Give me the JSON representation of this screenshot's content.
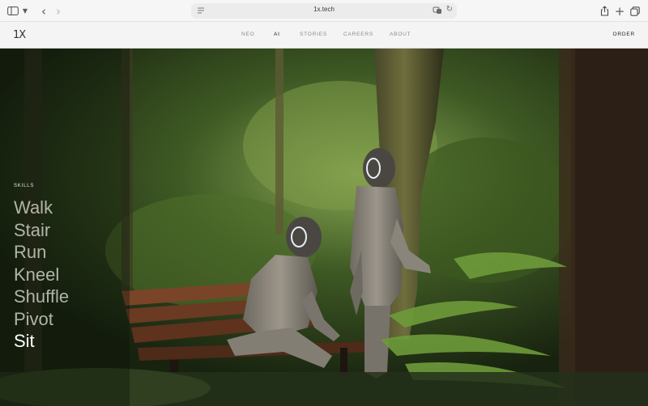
{
  "browser": {
    "url": "1x.tech",
    "icons": [
      "sidebar-icon",
      "chevron-down-icon",
      "back-icon",
      "forward-icon",
      "page-icon",
      "translate-icon",
      "reload-icon",
      "share-icon",
      "plus-icon",
      "tabs-icon"
    ]
  },
  "header": {
    "logo": "1X",
    "nav": [
      "NEO",
      "AI",
      "STORIES",
      "CAREERS",
      "ABOUT"
    ],
    "active_nav": "AI",
    "order": "ORDER"
  },
  "skills": {
    "label": "SKILLS",
    "items": [
      "Walk",
      "Stair",
      "Run",
      "Kneel",
      "Shuffle",
      "Pivot",
      "Sit"
    ],
    "active": "Sit"
  },
  "colors": {
    "forest_dark": "#1c2a16",
    "foliage": "#4e6a2c",
    "robot_body": "#8b867c",
    "bench": "#6a3c24",
    "chrome": "#f6f6f6"
  }
}
